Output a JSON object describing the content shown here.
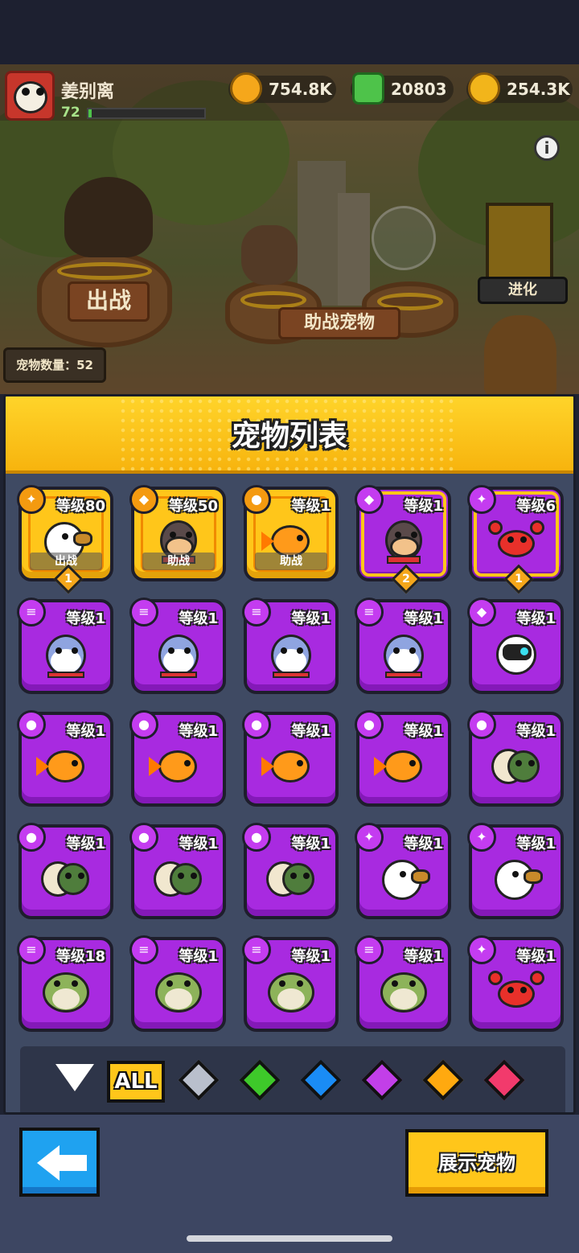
{
  "player": {
    "name": "姜别离",
    "level": "72",
    "xp_fraction": 0.03
  },
  "currencies": [
    {
      "name": "coin",
      "value": "754.8K",
      "color": "#f5a71b"
    },
    {
      "name": "gem",
      "value": "20803",
      "color": "#4ec34a"
    },
    {
      "name": "gold-plus",
      "value": "254.3K",
      "color": "#f2b51b"
    }
  ],
  "scene": {
    "deploy_label": "出战",
    "assist_label": "助战宠物",
    "evolve_label": "进化",
    "pet_count_label": "宠物数量：52",
    "info_icon": "i"
  },
  "panel": {
    "title": "宠物列表"
  },
  "pets": [
    {
      "level": "等级80",
      "species": "eagle",
      "element": "bird",
      "rarity": "gold",
      "role": "出战",
      "stars": "1"
    },
    {
      "level": "等级50",
      "species": "dog",
      "element": "dog",
      "rarity": "gold",
      "role": "助战",
      "stars": ""
    },
    {
      "level": "等级1",
      "species": "goldfish",
      "element": "turtle",
      "rarity": "gold",
      "role": "助战",
      "stars": ""
    },
    {
      "level": "等级1",
      "species": "dog",
      "element": "dog",
      "rarity": "purple-selected",
      "role": "",
      "stars": "2"
    },
    {
      "level": "等级6",
      "species": "crab",
      "element": "bird",
      "rarity": "purple-selected",
      "role": "",
      "stars": "1"
    },
    {
      "level": "等级1",
      "species": "cat",
      "element": "stack",
      "rarity": "purple",
      "role": "",
      "stars": ""
    },
    {
      "level": "等级1",
      "species": "cat",
      "element": "stack",
      "rarity": "purple",
      "role": "",
      "stars": ""
    },
    {
      "level": "等级1",
      "species": "cat",
      "element": "stack",
      "rarity": "purple",
      "role": "",
      "stars": ""
    },
    {
      "level": "等级1",
      "species": "cat",
      "element": "stack",
      "rarity": "purple",
      "role": "",
      "stars": ""
    },
    {
      "level": "等级1",
      "species": "robot",
      "element": "dog",
      "rarity": "purple",
      "role": "",
      "stars": ""
    },
    {
      "level": "等级1",
      "species": "goldfish",
      "element": "turtle",
      "rarity": "purple",
      "role": "",
      "stars": ""
    },
    {
      "level": "等级1",
      "species": "goldfish",
      "element": "turtle",
      "rarity": "purple",
      "role": "",
      "stars": ""
    },
    {
      "level": "等级1",
      "species": "goldfish",
      "element": "turtle",
      "rarity": "purple",
      "role": "",
      "stars": ""
    },
    {
      "level": "等级1",
      "species": "goldfish",
      "element": "turtle",
      "rarity": "purple",
      "role": "",
      "stars": ""
    },
    {
      "level": "等级1",
      "species": "turtle",
      "element": "turtle",
      "rarity": "purple",
      "role": "",
      "stars": ""
    },
    {
      "level": "等级1",
      "species": "turtle",
      "element": "turtle",
      "rarity": "purple",
      "role": "",
      "stars": ""
    },
    {
      "level": "等级1",
      "species": "turtle",
      "element": "turtle",
      "rarity": "purple",
      "role": "",
      "stars": ""
    },
    {
      "level": "等级1",
      "species": "turtle",
      "element": "turtle",
      "rarity": "purple",
      "role": "",
      "stars": ""
    },
    {
      "level": "等级1",
      "species": "eagle",
      "element": "bird",
      "rarity": "purple",
      "role": "",
      "stars": ""
    },
    {
      "level": "等级1",
      "species": "eagle",
      "element": "bird",
      "rarity": "purple",
      "role": "",
      "stars": ""
    },
    {
      "level": "等级18",
      "species": "frog",
      "element": "stack",
      "rarity": "purple",
      "role": "",
      "stars": ""
    },
    {
      "level": "等级1",
      "species": "frog",
      "element": "stack",
      "rarity": "purple",
      "role": "",
      "stars": ""
    },
    {
      "level": "等级1",
      "species": "frog",
      "element": "stack",
      "rarity": "purple",
      "role": "",
      "stars": ""
    },
    {
      "level": "等级1",
      "species": "frog",
      "element": "stack",
      "rarity": "purple",
      "role": "",
      "stars": ""
    },
    {
      "level": "等级1",
      "species": "crab",
      "element": "bird",
      "rarity": "purple",
      "role": "",
      "stars": ""
    }
  ],
  "filters": {
    "sort_icon": "triangle-down-icon",
    "all_label": "ALL",
    "gems": [
      {
        "name": "gray-gem",
        "color": "#b9bfcc"
      },
      {
        "name": "green-gem",
        "color": "#3ec92a"
      },
      {
        "name": "blue-gem",
        "color": "#1a8cf5"
      },
      {
        "name": "purple-gem",
        "color": "#c23fe8"
      },
      {
        "name": "orange-gem",
        "color": "#ffa90f"
      },
      {
        "name": "red-gem",
        "color": "#f23a6c"
      }
    ]
  },
  "footer": {
    "show_pet_label": "展示宠物"
  }
}
